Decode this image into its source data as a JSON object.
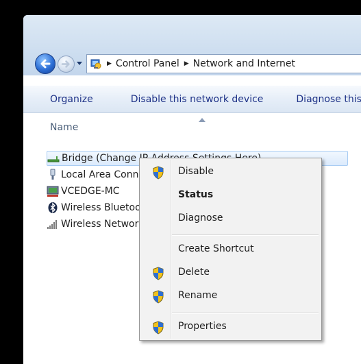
{
  "navigation": {
    "back_icon": "back-arrow-icon",
    "forward_icon": "forward-arrow-icon",
    "history_icon": "chevron-down-icon"
  },
  "address_bar": {
    "icon": "control-panel-icon",
    "crumbs": [
      "Control Panel",
      "Network and Internet"
    ],
    "separator": "▶"
  },
  "toolbar": {
    "organize_label": "Organize",
    "disable_label": "Disable this network device",
    "diagnose_label": "Diagnose this connection"
  },
  "list": {
    "column_name": "Name",
    "items": [
      {
        "label": "Bridge (Change IP Address Settings Here)",
        "icon": "network-bridge-icon",
        "selected": true
      },
      {
        "label": "Local Area Connection",
        "icon": "ethernet-icon"
      },
      {
        "label": "VCEDGE-MC",
        "icon": "network-adapter-icon"
      },
      {
        "label": "Wireless Bluetooth",
        "icon": "bluetooth-icon"
      },
      {
        "label": "Wireless Network Connection",
        "icon": "wireless-signal-icon"
      }
    ]
  },
  "context_menu": {
    "items": [
      {
        "label": "Disable",
        "shield": true
      },
      {
        "label": "Status",
        "bold": true
      },
      {
        "label": "Diagnose"
      },
      {
        "label": "Create Shortcut"
      },
      {
        "label": "Delete",
        "shield": true
      },
      {
        "label": "Rename",
        "shield": true
      },
      {
        "label": "Properties",
        "shield": true
      }
    ],
    "shield_icon": "uac-shield-icon"
  },
  "colors": {
    "link_blue": "#1e3287",
    "selection_border": "#a8ccf3",
    "menu_background": "#f2f2f2"
  }
}
